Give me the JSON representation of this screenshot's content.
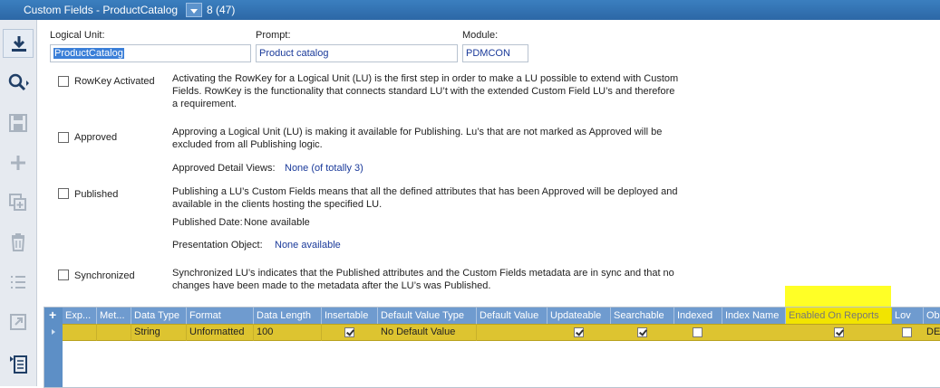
{
  "window": {
    "title": "Custom Fields - ProductCatalog",
    "count": "8 (47)"
  },
  "toolbar": {
    "items": [
      "download-icon",
      "search-icon",
      "save-icon",
      "add-icon",
      "duplicate-icon",
      "delete-icon",
      "list-icon",
      "open-icon",
      "notes-icon"
    ]
  },
  "fields": {
    "logical_unit_label": "Logical Unit:",
    "logical_unit_value": "ProductCatalog",
    "prompt_label": "Prompt:",
    "prompt_value": "Product catalog",
    "module_label": "Module:",
    "module_value": "PDMCON"
  },
  "options": {
    "rowkey": {
      "label": "RowKey Activated",
      "checked": false,
      "description": "Activating the RowKey for a Logical Unit (LU) is the first step in order to make a LU possible to extend with Custom Fields. RowKey is the functionality that connects standard LU’t with the extended Custom Field LU’s and therefore a requirement."
    },
    "approved": {
      "label": "Approved",
      "checked": false,
      "description": "Approving a Logical Unit (LU) is making it available for Publishing. Lu’s that are not marked as Approved will be excluded from all Publishing logic.",
      "detail_label": "Approved Detail Views:",
      "detail_value": "None (of totally 3)"
    },
    "published": {
      "label": "Published",
      "checked": false,
      "description": "Publishing a LU’s Custom Fields means that all the defined attributes that has been Approved will be deployed and available in the clients hosting the specified LU.",
      "date_label": "Published Date:",
      "date_value": "None available",
      "presentation_label": "Presentation Object:",
      "presentation_value": "None available"
    },
    "synchronized": {
      "label": "Synchronized",
      "checked": false,
      "description": "Synchronized LU’s indicates that the Published attributes and the Custom Fields metadata are in sync and that no changes have been made to the metadata after the LU’s was Published."
    }
  },
  "grid": {
    "add_symbol": "+",
    "columns": [
      "Exp...",
      "Met...",
      "Data Type",
      "Format",
      "Data Length",
      "Insertable",
      "Default Value Type",
      "Default Value",
      "Updateable",
      "Searchable",
      "Indexed",
      "Index Name",
      "Enabled On Reports",
      "Lov",
      "Ob"
    ],
    "row": {
      "data_type": "String",
      "format": "Unformatted",
      "data_length": "100",
      "insertable": true,
      "default_value_type": "No Default Value",
      "updateable": true,
      "searchable": true,
      "indexed": false,
      "enabled_on_reports": true,
      "lov": false,
      "object_partial": "DE"
    },
    "highlight_color": "#ffff00"
  }
}
